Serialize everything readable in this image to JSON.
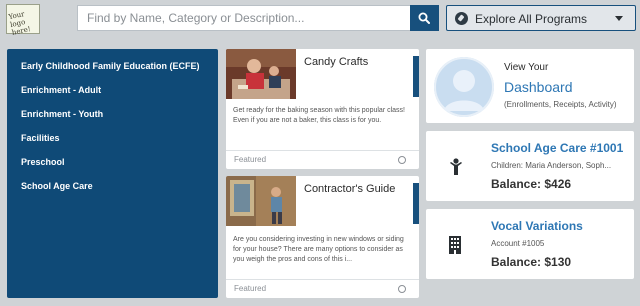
{
  "logo": {
    "text": "Your logo here!"
  },
  "search": {
    "placeholder": "Find by Name, Category or Description..."
  },
  "explore": {
    "label": "Explore All Programs"
  },
  "sidebar": {
    "items": [
      {
        "label": "Early Childhood Family Education (ECFE)"
      },
      {
        "label": "Enrichment - Adult"
      },
      {
        "label": "Enrichment - Youth"
      },
      {
        "label": "Facilities"
      },
      {
        "label": "Preschool"
      },
      {
        "label": "School Age Care"
      }
    ]
  },
  "programs": [
    {
      "title": "Candy Crafts",
      "description": "Get ready for the baking season with this popular class! Even if you are not a baker, this class is for you.",
      "tag": "Featured"
    },
    {
      "title": "Contractor's Guide",
      "description": "Are you considering investing in new windows or siding for your house? There are many options to consider as you weigh the pros and cons of this i...",
      "tag": "Featured"
    }
  ],
  "dashboard": {
    "view_your": "View Your",
    "title": "Dashboard",
    "subtitle": "(Enrollments, Receipts, Activity)"
  },
  "accounts": [
    {
      "title": "School Age Care #1001",
      "line": "Children: Maria Anderson, Soph...",
      "balance": "Balance: $426",
      "icon": "child-icon"
    },
    {
      "title": "Vocal Variations",
      "line": "Account #1005",
      "balance": "Balance: $130",
      "icon": "building-icon"
    }
  ],
  "colors": {
    "brand_navy": "#0f4a77",
    "link_blue": "#2e77b4",
    "background": "#cfd3d6"
  }
}
